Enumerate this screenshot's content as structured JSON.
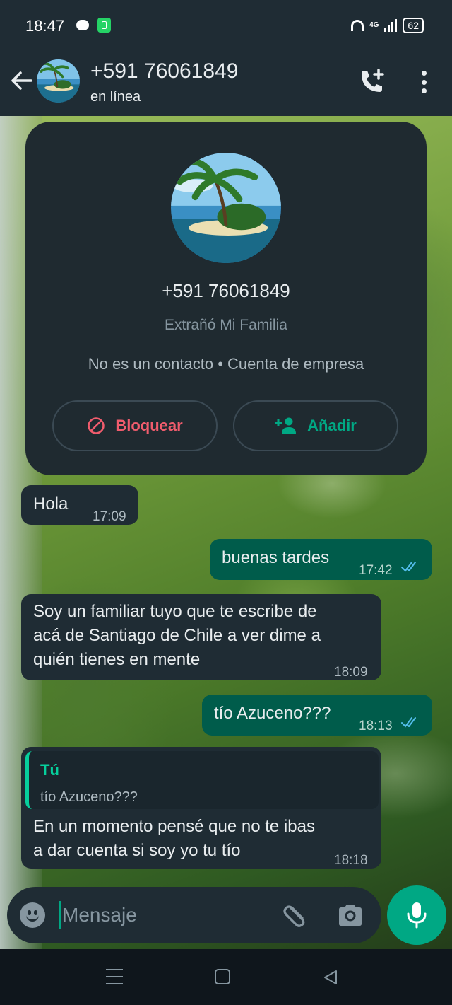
{
  "status_bar": {
    "time": "18:47",
    "network": "4G",
    "battery": "62"
  },
  "header": {
    "title": "+591 76061849",
    "subtitle": "en línea"
  },
  "info_card": {
    "number": "+591 76061849",
    "name": "Extrañó Mi Familia",
    "meta": "No es un contacto • Cuenta de empresa",
    "block_label": "Bloquear",
    "add_label": "Añadir"
  },
  "messages": [
    {
      "direction": "in",
      "text": "Hola",
      "time": "17:09"
    },
    {
      "direction": "out",
      "text": "buenas tardes",
      "time": "17:42",
      "status": "read"
    },
    {
      "direction": "in",
      "lines": [
        "Soy un familiar tuyo que te escribe de",
        "acá de Santiago de Chile a ver dime a",
        "quién tienes en mente"
      ],
      "time": "18:09"
    },
    {
      "direction": "out",
      "text": "tío Azuceno???",
      "time": "18:13",
      "status": "read"
    },
    {
      "direction": "in",
      "reply_to": {
        "author": "Tú",
        "text": "tío Azuceno???"
      },
      "lines": [
        "En un momento pensé que no te ibas",
        "a dar cuenta si soy yo tu tío"
      ],
      "time": "18:18"
    }
  ],
  "composer": {
    "placeholder": "Mensaje"
  },
  "colors": {
    "header_bg": "#1f2c34",
    "incoming_bubble": "#1f2c34",
    "outgoing_bubble": "#005c4b",
    "accent": "#00a884",
    "danger": "#f15c6d",
    "read_ticks": "#53bdeb"
  },
  "icons": [
    "back-arrow-icon",
    "add-call-icon",
    "more-vert-icon",
    "block-icon",
    "person-add-icon",
    "emoji-icon",
    "attach-icon",
    "camera-icon",
    "mic-icon",
    "read-ticks-icon",
    "nav-menu-icon",
    "nav-home-icon",
    "nav-back-icon"
  ]
}
